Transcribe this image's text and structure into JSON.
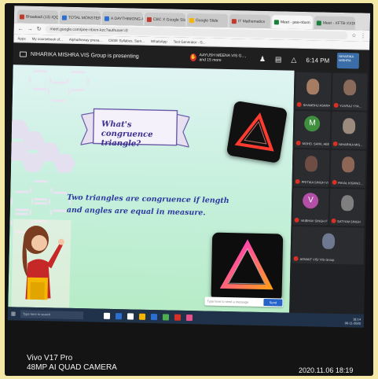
{
  "browser": {
    "tabs": [
      {
        "label": "Bhaakadi (13) IQQAR",
        "color": "#c0392b"
      },
      {
        "label": "TOTAL MONSTER X",
        "color": "#2d6fd1"
      },
      {
        "label": "A DAYTHIMONG ALERE",
        "color": "#2d6fd1"
      },
      {
        "label": "CBC X Google Slide",
        "color": "#c0392b"
      },
      {
        "label": "Google Slide",
        "color": "#f4b400"
      },
      {
        "label": "IT Mathematics",
        "color": "#c0392b"
      },
      {
        "label": "Meet - pee-nbxm",
        "color": "#188038",
        "active": true
      },
      {
        "label": "Meet - XFTB-XXDB",
        "color": "#188038"
      }
    ],
    "url": "meet.google.com/pee-nbxm-kzc?authuser=0",
    "bookmarks": [
      "Apps",
      "My coursebook of...",
      "Alphatheway presa...",
      "CBSE Syllabus, Sam...",
      "WhatsApp",
      "Test Generator - G..."
    ]
  },
  "meet": {
    "presenting_text": "NIHARIKA MISHRA VIS Group is presenting",
    "raised_hand_text": "AAYUSH MEENA VIS G..., and 15 more",
    "time": "6:14 PM",
    "mini_thumb_label": "NIHARIKA MISHRA"
  },
  "slide": {
    "title_line1": "What's congruence",
    "title_line2": "triangle?",
    "body_line1": "Two triangles are congruence if length",
    "body_line2": "and angles are equal in measure.",
    "chat_placeholder": "Type here to send a message",
    "chat_send_label": "Send",
    "neon_colors": {
      "triangle1": "#ff3b30",
      "triangle2_a": "#ff2fd0",
      "triangle2_b": "#ff9a1f"
    }
  },
  "participants": [
    {
      "name": "SHAMBHU ASARAM ...",
      "kind": "photo",
      "color": "#a67c63"
    },
    {
      "name": "YUVRAJ YYA...",
      "kind": "photo",
      "color": "#8a6a5a"
    },
    {
      "name": "MOHD. SAHIL ABBA...",
      "kind": "letter",
      "letter": "M",
      "color": "#3f8f3f"
    },
    {
      "name": "NIHARIKA MIS...",
      "kind": "photo",
      "color": "#9b8b7e"
    },
    {
      "name": "PRITIKA SINGH VIS...",
      "kind": "photo",
      "color": "#6d4d44"
    },
    {
      "name": "PAYAL KISHNO...",
      "kind": "photo",
      "color": "#8d6656"
    },
    {
      "name": "VAIBHAV SINGH FR...",
      "kind": "letter",
      "letter": "V",
      "color": "#b44fa8"
    },
    {
      "name": "SATYAM SINGH",
      "kind": "photo",
      "color": "#7f7f7f"
    },
    {
      "name": "ADWAIT VIS/ VIS Group",
      "kind": "photo",
      "color": "#6f7891",
      "wide": true
    }
  ],
  "taskbar": {
    "search_placeholder": "Type here to search",
    "icon_colors": [
      "#ffffff",
      "#2d6fd1",
      "#ffffff",
      "#f4b400",
      "#2d6fd1",
      "#4caf50",
      "#d93025",
      "#e94f8a"
    ],
    "tray_time": "18:14",
    "tray_date": "06-11-2020"
  },
  "watermark": {
    "model": "Vivo V17 Pro",
    "camera": "48MP AI QUAD CAMERA",
    "timestamp": "2020.11.06 18:19"
  }
}
